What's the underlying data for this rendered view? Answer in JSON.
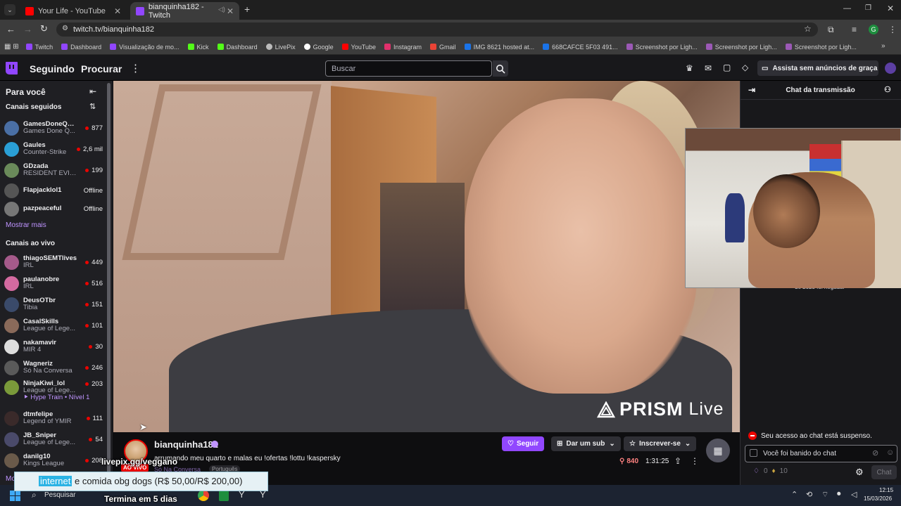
{
  "browser": {
    "tabs": [
      {
        "title": "Your Life - YouTube",
        "favicon": "youtube-icon",
        "color": "#ff0000"
      },
      {
        "title": "bianquinha182 - Twitch",
        "favicon": "twitch-icon",
        "color": "#9146ff"
      }
    ],
    "url": "twitch.tv/bianquinha182",
    "profile_initial": "G",
    "bookmarks": [
      {
        "label": "Twitch",
        "color": "#9146ff"
      },
      {
        "label": "Dashboard",
        "color": "#9146ff"
      },
      {
        "label": "Visualização de mo...",
        "color": "#9146ff"
      },
      {
        "label": "Kick",
        "color": "#53fc18"
      },
      {
        "label": "Dashboard",
        "color": "#53fc18"
      },
      {
        "label": "LivePix",
        "color": "#bbbbbb"
      },
      {
        "label": "Google",
        "color": "#ffffff"
      },
      {
        "label": "YouTube",
        "color": "#ff0000"
      },
      {
        "label": "Instagram",
        "color": "#e1306c"
      },
      {
        "label": "Gmail",
        "color": "#ea4335"
      },
      {
        "label": "IMG 8621 hosted at...",
        "color": "#1a73e8"
      },
      {
        "label": "668CAFCE 5F03 491...",
        "color": "#1a73e8"
      },
      {
        "label": "Screenshot por Ligh...",
        "color": "#9b59b6"
      },
      {
        "label": "Screenshot por Ligh...",
        "color": "#9b59b6"
      },
      {
        "label": "Screenshot por Ligh...",
        "color": "#9b59b6"
      }
    ]
  },
  "topnav": {
    "following": "Seguindo",
    "browse": "Procurar",
    "search_placeholder": "Buscar",
    "ad_free": "Assista sem anúncios de graça"
  },
  "sidebar": {
    "title": "Para você",
    "followed_title": "Canais seguidos",
    "followed": [
      {
        "name": "GamesDoneQui...",
        "game": "Games Done Q...",
        "viewers": "877",
        "color": "#4a6fa5"
      },
      {
        "name": "Gaules",
        "game": "Counter-Strike",
        "viewers": "2,6 mil",
        "color": "#2a9fd6"
      },
      {
        "name": "GDzada",
        "game": "RESIDENT EVIL...",
        "viewers": "199",
        "color": "#6a8a5a"
      },
      {
        "name": "Flapjacklol1",
        "game": "",
        "viewers": "Offline",
        "color": "#555555"
      },
      {
        "name": "pazpeaceful",
        "game": "",
        "viewers": "Offline",
        "color": "#777777"
      }
    ],
    "show_more": "Mostrar mais",
    "live_title": "Canais ao vivo",
    "live": [
      {
        "name": "thiagoSEMTlives",
        "game": "IRL",
        "viewers": "449",
        "color": "#a55a8a"
      },
      {
        "name": "paulanobre",
        "game": "IRL",
        "viewers": "516",
        "color": "#d46aa0"
      },
      {
        "name": "DeusOTbr",
        "game": "Tibia",
        "viewers": "151",
        "color": "#3a4a6a"
      },
      {
        "name": "CasalSkills",
        "game": "League of Lege...",
        "viewers": "101",
        "color": "#8a6a5a"
      },
      {
        "name": "nakamavir",
        "game": "MIR 4",
        "viewers": "30",
        "color": "#dddddd"
      },
      {
        "name": "Wagneriz",
        "game": "Só Na Conversa",
        "viewers": "246",
        "color": "#5a5a5a"
      },
      {
        "name": "NinjaKiwi_lol",
        "game": "League of Lege...",
        "viewers": "203",
        "color": "#7a9a3a"
      },
      {
        "name": "dtmfelipe",
        "game": "Legend of YMIR",
        "viewers": "111",
        "color": "#3a2a2a"
      },
      {
        "name": "JB_Sniper",
        "game": "League of Lege...",
        "viewers": "54",
        "color": "#4a4a6a"
      },
      {
        "name": "danilg10",
        "game": "Kings League",
        "viewers": "208",
        "color": "#6a5a4a"
      }
    ],
    "hype_train": "Hype Train • Nível 1",
    "more_cut": "Mo"
  },
  "video": {
    "watermark": "PRISM",
    "watermark_suffix": "Live"
  },
  "stream": {
    "channel": "bianquinha182",
    "title": "arrumando meu quarto e malas eu !ofertas !lottu !kaspersky",
    "category": "Só Na Conversa",
    "language": "Português",
    "live_badge": "AO VIVO",
    "follow": "Seguir",
    "gift_sub": "Dar um sub",
    "subscribe": "Inscrever-se",
    "viewers": "840",
    "uptime": "1:31:25"
  },
  "overlay": {
    "livepix": "livepix.gg/veggano",
    "donation_hl": "internet",
    "donation_rest": " e comida obg dogs (R$ 50,00/R$ 200,00)",
    "ends": "Termina em 5 dias"
  },
  "chat": {
    "title": "Chat da transmissão",
    "cutoff_line": "de 2025 foi negada.",
    "suspended": "Seu acesso ao chat está suspenso.",
    "banned": "Você foi banido do chat",
    "points1": "0",
    "points2": "10",
    "chat_button": "Chat"
  },
  "taskbar": {
    "search": "Pesquisar",
    "time": "12:15",
    "date": "15/03/2026"
  }
}
